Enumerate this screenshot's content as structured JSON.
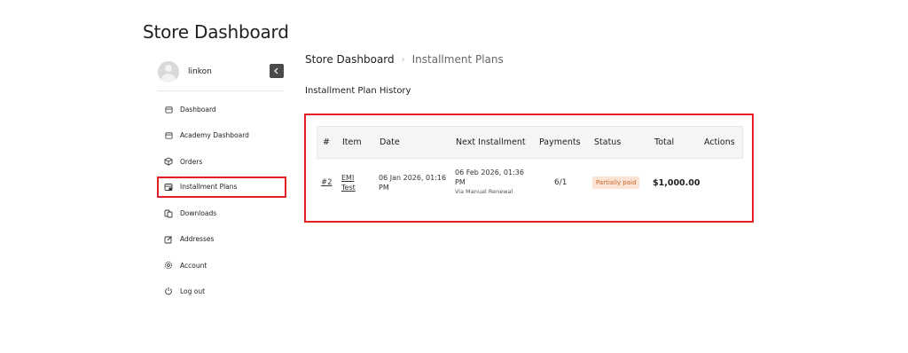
{
  "page": {
    "title": "Store Dashboard"
  },
  "user": {
    "name": "linkon"
  },
  "sidebar": {
    "items": [
      {
        "label": "Dashboard",
        "icon": "dashboard-icon"
      },
      {
        "label": "Academy Dashboard",
        "icon": "academy-icon"
      },
      {
        "label": "Orders",
        "icon": "orders-icon"
      },
      {
        "label": "Installment Plans",
        "icon": "installment-icon"
      },
      {
        "label": "Downloads",
        "icon": "downloads-icon"
      },
      {
        "label": "Addresses",
        "icon": "addresses-icon"
      },
      {
        "label": "Account",
        "icon": "gear-icon"
      },
      {
        "label": "Log out",
        "icon": "power-icon"
      }
    ]
  },
  "breadcrumb": {
    "root": "Store Dashboard",
    "current": "Installment Plans"
  },
  "section": {
    "title": "Installment Plan History"
  },
  "table": {
    "headers": [
      "#",
      "Item",
      "Date",
      "Next Installment",
      "Payments",
      "Status",
      "Total",
      "Actions"
    ],
    "rows": [
      {
        "id": "#2",
        "item_line1": "EMI",
        "item_line2": "Test",
        "date_line1": "06 Jan 2026, 01:16",
        "date_line2": "PM",
        "next_line1": "06 Feb 2026, 01:36",
        "next_line2": "PM",
        "next_note": "Via Manual Renewal",
        "payments": "6/1",
        "status": "Partially paid",
        "total": "$1,000.00"
      }
    ]
  },
  "colors": {
    "highlight": "#e31e24",
    "badge_bg": "#fbe4d5",
    "badge_text": "#c4652a"
  }
}
